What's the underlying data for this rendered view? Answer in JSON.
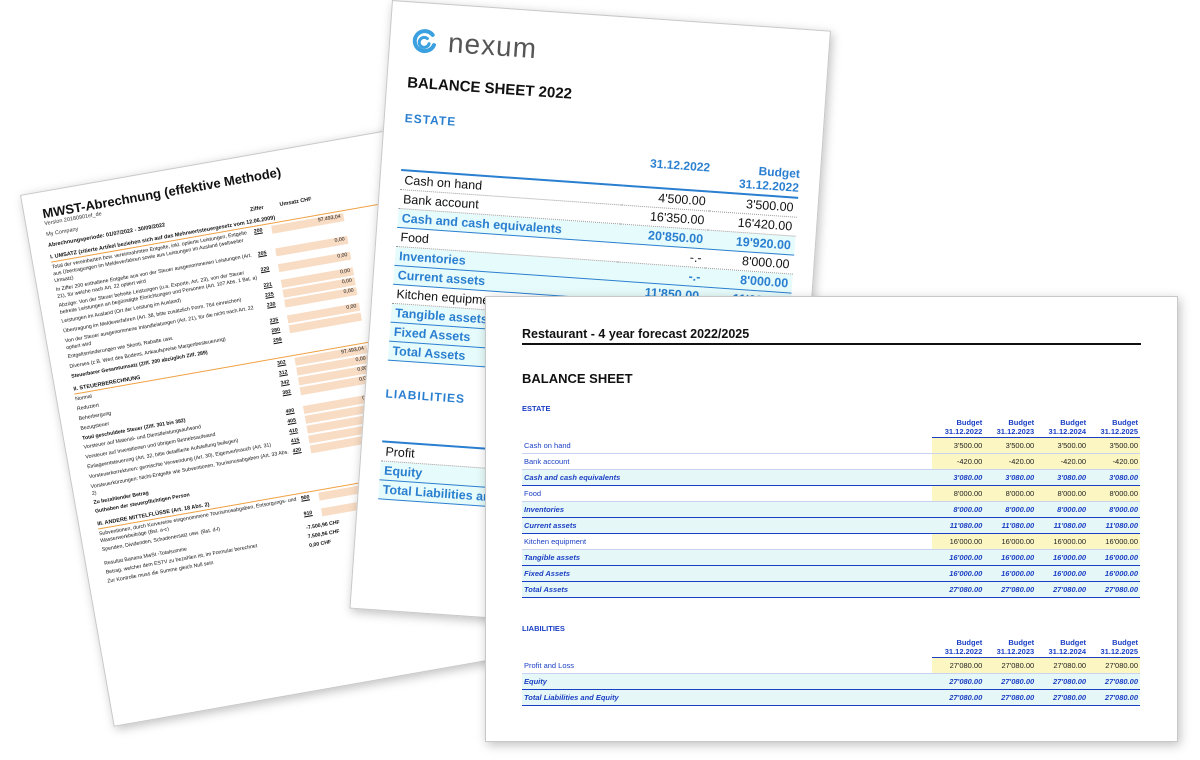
{
  "mwst": {
    "title": "MWST-Abrechnung (effektive Methode)",
    "version": "Version 20180901ef_de",
    "company": "My Company",
    "period": "Abrechnungsperiode: 01/07/2022 - 30/09/2022",
    "col_ziffer": "Ziffer",
    "col_umsatz": "Umsatz CHF",
    "sec1": "I. UMSATZ (zitierte Artikel beziehen sich auf das Mehrwertsteuergesetz vom 12.06.2009)",
    "rows1": [
      {
        "text": "Total der vereinbarten bzw. vereinnahmten Entgelte, inkl. optierte Leistungen, Entgelte aus Übertragungen im Meldeverfahren sowie aus Leistungen im Ausland (weltweiter Umsatz)",
        "code": "200",
        "value": "97.493,04"
      },
      {
        "text": "In Ziffer 200 enthaltene Entgelte aus von der Steuer ausgenommenen Leistungen (Art. 21), für welche nach Art. 22 optiert wird",
        "code": "205",
        "value": "0,00"
      },
      {
        "text": "Abzüge: Von der Steuer befreite Leistungen (u.a. Exporte, Art. 23), von der Steuer befreite Leistungen an begünstigte Einrichtungen und Personen (Art. 107 Abs. 1 Bst. a)",
        "code": "220",
        "value": "0,00"
      },
      {
        "text": "Leistungen im Ausland (Ort der Leistung im Ausland)",
        "code": "221",
        "value": "0,00"
      },
      {
        "text": "Übertragung im Meldeverfahren (Art. 38, bitte zusätzlich Form. 764 einreichen)",
        "code": "225",
        "value": "0,00"
      },
      {
        "text": "Von der Steuer ausgenommene Inlandleistungen (Art. 21), für die nicht nach Art. 22 optiert wird",
        "code": "230",
        "value": "0,00"
      },
      {
        "text": "Entgeltsminderungen wie Skonti, Rabatte usw.",
        "code": "235",
        "value": "0,00"
      },
      {
        "text": "Diverses (z.B. Wert des Bodens, Ankaufspreise Margenbesteuerung)",
        "code": "280",
        "value": ""
      }
    ],
    "total1": "Steuerbarer Gesamtumsatz (Ziff. 200 abzüglich Ziff. 289)",
    "total1_code": "299",
    "sec2": "II. STEUERBERECHNUNG",
    "rows2": [
      {
        "text": "Normal",
        "code": "302",
        "value": "97.493,04"
      },
      {
        "text": "Reduziert",
        "code": "312",
        "value": "0,00"
      },
      {
        "text": "Beherbergung",
        "code": "342",
        "value": "0,00"
      },
      {
        "text": "Bezugsteuer",
        "code": "382",
        "value": "0,00"
      }
    ],
    "total2": "Total geschuldete Steuer (Ziff. 301 bis 382)",
    "rows3": [
      {
        "text": "Vorsteuer auf Material- und Dienstleistungsaufwand",
        "code": "400",
        "value": "0,00"
      },
      {
        "text": "Vorsteuer auf Investitionen und übrigem Betriebsaufwand",
        "code": "405",
        "value": "0,00"
      },
      {
        "text": "Einlageentsteuerung (Art. 32, bitte detaillierte Aufstellung beilegen)",
        "code": "410",
        "value": "0,00"
      },
      {
        "text": "Vorsteuerkorrekturen: gemischte Verwendung (Art. 30), Eigenverbrauch (Art. 31)",
        "code": "415",
        "value": "0,00"
      },
      {
        "text": "Vorsteuerkürzungen: Nicht-Entgelte wie Subventionen, Tourismusabgaben (Art. 33 Abs. 2)",
        "code": "420",
        "value": "0,00"
      }
    ],
    "to_pay": "Zu bezahlender Betrag",
    "credit": "Guthaben der steuerpflichtigen Person",
    "sec3": "III. ANDERE MITTELFLÜSSE (Art. 18 Abs. 2)",
    "rows4": [
      {
        "text": "Subventionen, durch Kurvereine eingenommene Tourismusabgaben, Entsorgungs- und Wasserwerkbeiträge (Bst. a-c)",
        "code": "900",
        "value": "0,00"
      },
      {
        "text": "Spenden, Dividenden, Schadenersatz usw. (Bst. d-l)",
        "code": "910",
        "value": "0,00"
      }
    ],
    "result1": "Resultat Banana MwSt -Totalsumme",
    "result1_val": "-7.500,96 CHF",
    "result2": "Betrag, welcher dem ESTV zu bezahlen ist, im Formular berechnet",
    "result2_val": "7.500,96 CHF",
    "result3": "Zur Kontrolle muss die Summe gleich Null sein",
    "result3_val": "0,00 CHF"
  },
  "nexum": {
    "logo": "nexum",
    "title": "BALANCE SHEET 2022",
    "estate": "ESTATE",
    "col1": "31.12.2022",
    "col2": "Budget 31.12.2022",
    "rows": [
      {
        "label": "Cash on hand",
        "v1": "4'500.00",
        "v2": "3'500.00",
        "total": false
      },
      {
        "label": "Bank account",
        "v1": "16'350.00",
        "v2": "16'420.00",
        "total": false
      },
      {
        "label": "Cash and cash equivalents",
        "v1": "20'850.00",
        "v2": "19'920.00",
        "total": true
      },
      {
        "label": "Food",
        "v1": "-.-",
        "v2": "8'000.00",
        "total": false
      },
      {
        "label": "Inventories",
        "v1": "-.-",
        "v2": "8'000.00",
        "total": true
      },
      {
        "label": "Current assets",
        "v1": "11'850.00",
        "v2": "11'080.00",
        "total": true
      },
      {
        "label": "Kitchen equipment",
        "v1": "",
        "v2": "",
        "total": false
      },
      {
        "label": "Tangible assets",
        "v1": "",
        "v2": "",
        "total": true
      },
      {
        "label": "Fixed Assets",
        "v1": "",
        "v2": "",
        "total": true
      },
      {
        "label": "Total Assets",
        "v1": "",
        "v2": "",
        "total": true
      }
    ],
    "liabilities": "LIABILITIES",
    "rows2": [
      {
        "label": "Profit",
        "total": false
      },
      {
        "label": "Equity",
        "total": true
      },
      {
        "label": "Total Liabilities and Equity",
        "total": true
      }
    ]
  },
  "forecast": {
    "title": "Restaurant - 4 year forecast 2022/2025",
    "subtitle": "BALANCE SHEET",
    "estate": "ESTATE",
    "liabilities": "LIABILITIES",
    "headers": [
      "Budget 31.12.2022",
      "Budget 31.12.2023",
      "Budget 31.12.2024",
      "Budget 31.12.2025"
    ],
    "assets": [
      {
        "label": "Cash on hand",
        "values": [
          "3'500.00",
          "3'500.00",
          "3'500.00",
          "3'500.00"
        ],
        "total": false
      },
      {
        "label": "Bank account",
        "values": [
          "-420.00",
          "-420.00",
          "-420.00",
          "-420.00"
        ],
        "total": false
      },
      {
        "label": "Cash and cash equivalents",
        "values": [
          "3'080.00",
          "3'080.00",
          "3'080.00",
          "3'080.00"
        ],
        "total": true
      },
      {
        "label": "Food",
        "values": [
          "8'000.00",
          "8'000.00",
          "8'000.00",
          "8'000.00"
        ],
        "total": false
      },
      {
        "label": "Inventories",
        "values": [
          "8'000.00",
          "8'000.00",
          "8'000.00",
          "8'000.00"
        ],
        "total": true
      },
      {
        "label": "Current assets",
        "values": [
          "11'080.00",
          "11'080.00",
          "11'080.00",
          "11'080.00"
        ],
        "total": true
      },
      {
        "label": "Kitchen equipment",
        "values": [
          "16'000.00",
          "16'000.00",
          "16'000.00",
          "16'000.00"
        ],
        "total": false
      },
      {
        "label": "Tangible assets",
        "values": [
          "16'000.00",
          "16'000.00",
          "16'000.00",
          "16'000.00"
        ],
        "total": true
      },
      {
        "label": "Fixed Assets",
        "values": [
          "16'000.00",
          "16'000.00",
          "16'000.00",
          "16'000.00"
        ],
        "total": true
      },
      {
        "label": "Total Assets",
        "values": [
          "27'080.00",
          "27'080.00",
          "27'080.00",
          "27'080.00"
        ],
        "total": true
      }
    ],
    "liab_rows": [
      {
        "label": "Profit and Loss",
        "values": [
          "27'080.00",
          "27'080.00",
          "27'080.00",
          "27'080.00"
        ],
        "total": false
      },
      {
        "label": "Equity",
        "values": [
          "27'080.00",
          "27'080.00",
          "27'080.00",
          "27'080.00"
        ],
        "total": true
      },
      {
        "label": "Total Liabilities and Equity",
        "values": [
          "27'080.00",
          "27'080.00",
          "27'080.00",
          "27'080.00"
        ],
        "total": true
      }
    ],
    "colors": {
      "accent": "#1a3fc4",
      "highlight": "#fbf6c2",
      "total_bg": "#e6f7f7"
    }
  }
}
